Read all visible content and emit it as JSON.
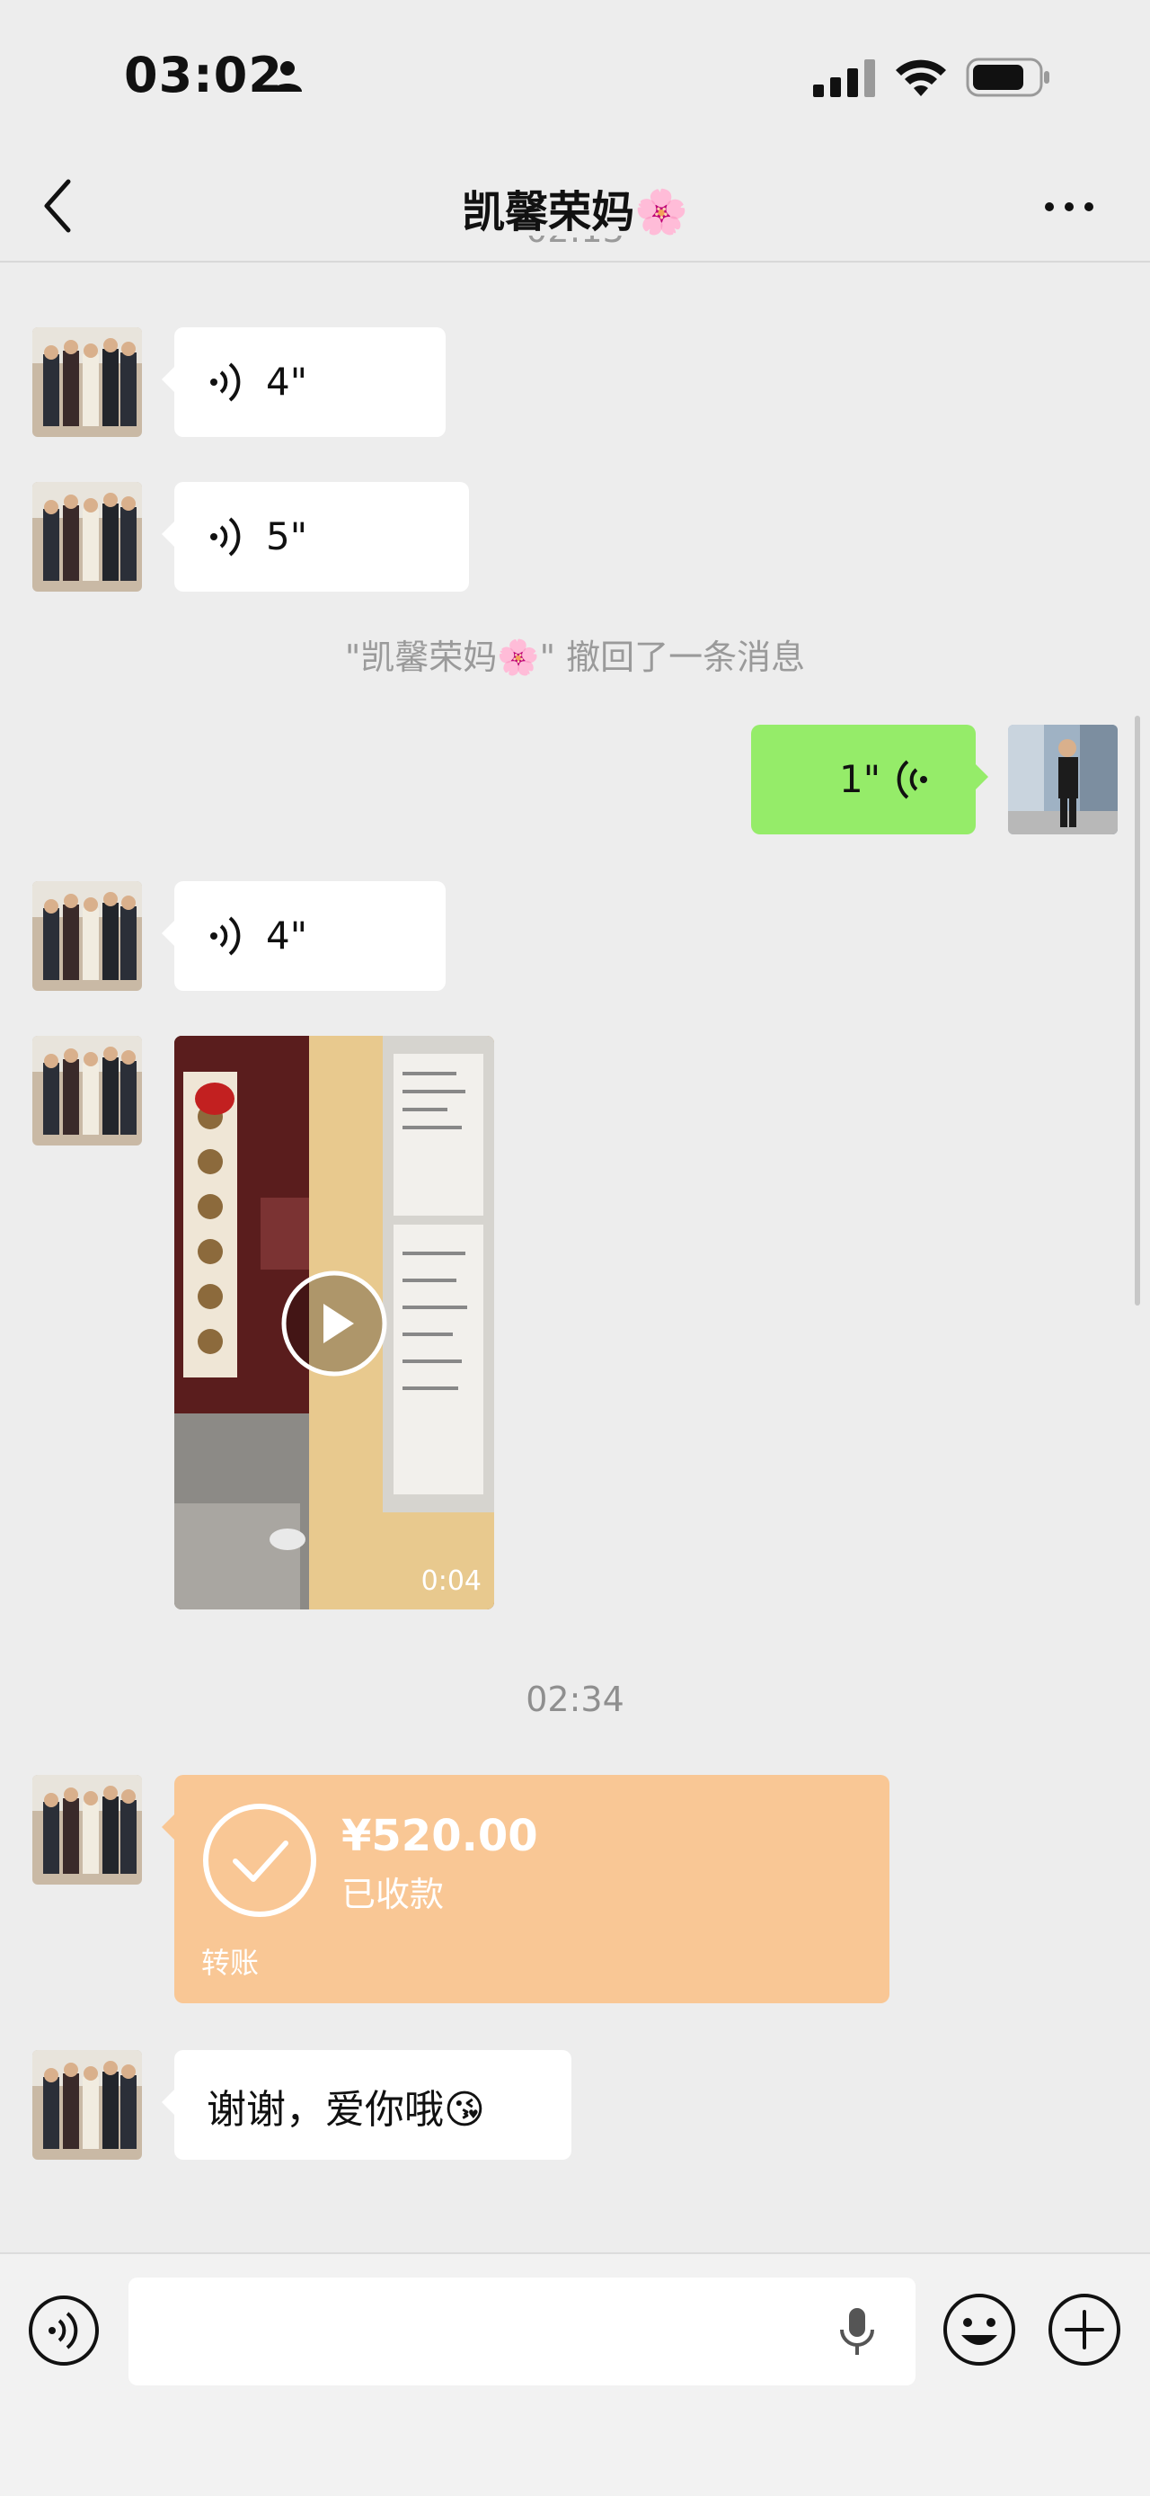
{
  "status_bar": {
    "time": "03:02"
  },
  "nav": {
    "title": "凯馨荣妈🌸"
  },
  "messages": {
    "top_time_partial": "02:13",
    "voice1": "4\"",
    "voice2": "5\"",
    "recall": "\"凯馨荣妈🌸\" 撤回了一条消息",
    "voice_self": "1\"",
    "voice3": "4\"",
    "video_duration": "0:04",
    "timestamp": "02:34",
    "transfer_amount": "¥520.00",
    "transfer_status": "已收款",
    "transfer_label": "转账",
    "text1": "谢谢，爱你哦😘"
  },
  "colors": {
    "background": "#ededed",
    "self_bubble": "#95ec69",
    "transfer_bubble": "#f9c795"
  }
}
